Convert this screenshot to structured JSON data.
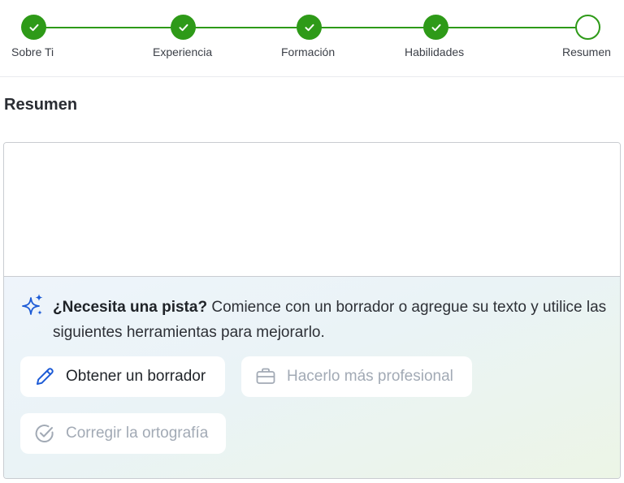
{
  "stepper": {
    "steps": [
      {
        "label": "Sobre Ti",
        "state": "done"
      },
      {
        "label": "Experiencia",
        "state": "done"
      },
      {
        "label": "Formación",
        "state": "done"
      },
      {
        "label": "Habilidades",
        "state": "done"
      },
      {
        "label": "Resumen",
        "state": "current"
      }
    ],
    "accent_color": "#2e9a18"
  },
  "section": {
    "title": "Resumen"
  },
  "editor": {
    "value": "",
    "hint": {
      "lead": "¿Necesita una pista?",
      "body": " Comience con un borrador o agregue su texto y utilice las siguientes herramientas para mejorarlo.",
      "icon": "sparkles-icon"
    },
    "tools": [
      {
        "label": "Obtener un borrador",
        "icon": "pencil-icon",
        "enabled": true
      },
      {
        "label": "Hacerlo más profesional",
        "icon": "briefcase-icon",
        "enabled": false
      },
      {
        "label": "Corregir la ortografía",
        "icon": "check-circle-icon",
        "enabled": false
      }
    ]
  }
}
